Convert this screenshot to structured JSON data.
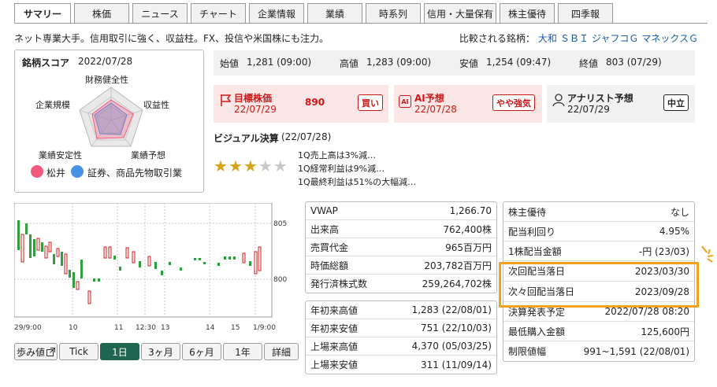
{
  "tabs": [
    "サマリー",
    "株価",
    "ニュース",
    "チャート",
    "企業情報",
    "業績",
    "時系列",
    "信用・大量保有",
    "株主優待",
    "四季報"
  ],
  "description": "ネット専業大手。信用取引に強く、収益柱。FX、投信や米国株にも注力。",
  "compare": {
    "label": "比較される銘柄：",
    "links": [
      "大和",
      "ＳＢＩ",
      "ジャフコＧ",
      "マネックスＧ"
    ]
  },
  "score": {
    "title": "銘柄スコア",
    "date": "2022/07/28",
    "axes": [
      "財務健全性",
      "収益性",
      "業績予想",
      "業績安定性",
      "企業規模"
    ],
    "legend": [
      {
        "name": "松井",
        "color": "#f05a7e"
      },
      {
        "name": "証券、商品先物取引業",
        "color": "#4a90e2"
      }
    ]
  },
  "prices": [
    {
      "label": "始値",
      "value": "1,281 (09:00)"
    },
    {
      "label": "高値",
      "value": "1,283 (09:00)"
    },
    {
      "label": "安値",
      "value": "1,254 (09:47)"
    },
    {
      "label": "終値",
      "value": "803 (07/29)"
    }
  ],
  "target_price": {
    "title": "目標株価",
    "date": "22/07/29",
    "value": "890",
    "tag": "買い"
  },
  "ai_forecast": {
    "icon": "AI",
    "title": "AI予想",
    "date": "22/07/28",
    "tag": "やや強気"
  },
  "analyst": {
    "title": "アナリスト予想",
    "date": "22/07/29",
    "tag": "中立"
  },
  "visual": {
    "title": "ビジュアル決算",
    "date": "(22/07/28)",
    "stars": 3,
    "star_max": 5,
    "lines": [
      "1Q売上高は3%減…",
      "1Q経常利益は9%減…",
      "1Q最終利益は51%の大幅減…"
    ]
  },
  "chart": {
    "y_labels": [
      "805",
      "800"
    ],
    "x_labels": [
      "29/9:00",
      "10",
      "11",
      "12:30",
      "13",
      "14",
      "15",
      "1/9:00"
    ]
  },
  "chart_buttons": [
    "歩み値",
    "Tick",
    "1日",
    "3ヶ月",
    "6ヶ月",
    "1年",
    "詳細"
  ],
  "table1": [
    {
      "label": "VWAP",
      "value": "1,266.70"
    },
    {
      "label": "出来高",
      "value": "762,400株"
    },
    {
      "label": "売買代金",
      "value": "965百万円"
    },
    {
      "label": "時価総額",
      "value": "203,782百万円"
    },
    {
      "label": "発行済株式数",
      "value": "259,264,702株"
    }
  ],
  "table2": [
    {
      "label": "年初来高値",
      "value": "1,283 (22/08/01)"
    },
    {
      "label": "年初来安値",
      "value": "751 (22/10/03)"
    },
    {
      "label": "上場来高値",
      "value": "4,370 (05/03/25)"
    },
    {
      "label": "上場来安値",
      "value": "311 (11/09/14)"
    }
  ],
  "table3": [
    {
      "label": "株主優待",
      "value": "なし"
    },
    {
      "label": "配当利回り",
      "value": "4.95%"
    },
    {
      "label": "1株配当金額",
      "value": "-円 (23/03)"
    },
    {
      "label": "次回配当落日",
      "value": "2023/03/30"
    },
    {
      "label": "次々回配当落日",
      "value": "2023/09/28"
    },
    {
      "label": "決算発表予定",
      "value": "2022/07/28 08:20"
    },
    {
      "label": "最低購入金額",
      "value": "125,600円"
    },
    {
      "label": "制限値幅",
      "value": "991~1,591 (22/08/01)"
    }
  ],
  "colors": {
    "accent": "#1f6650",
    "up": "#2e9e3e",
    "down": "#d01818",
    "highlight": "#f2a31b"
  }
}
